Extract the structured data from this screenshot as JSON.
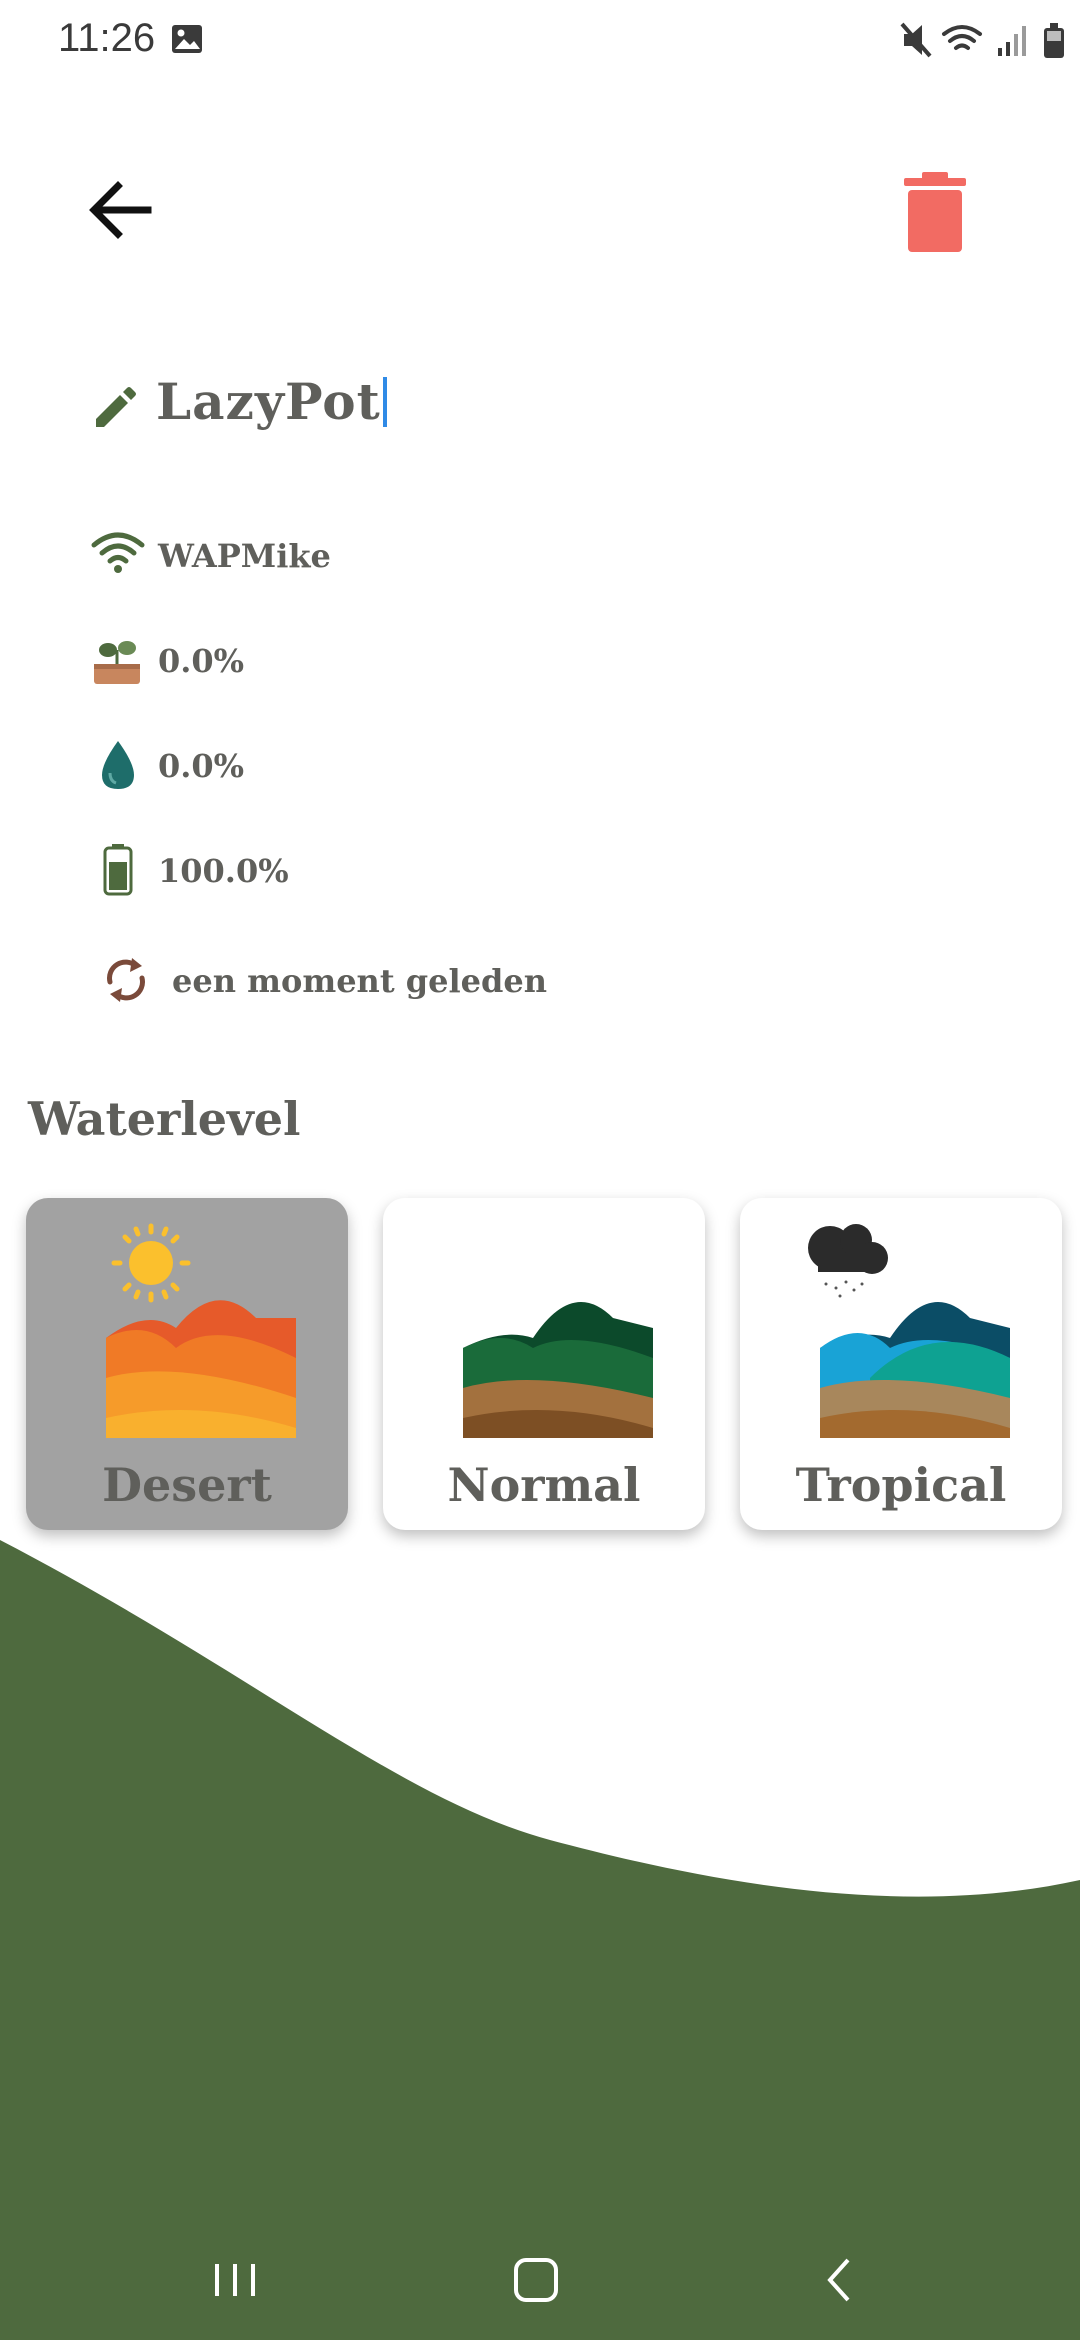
{
  "status_bar": {
    "time": "11:26",
    "icons": [
      "gallery-icon",
      "mute-icon",
      "wifi-icon",
      "signal-icon",
      "battery-icon"
    ]
  },
  "toolbar": {
    "back_icon": "arrow-left-icon",
    "delete_icon": "trash-icon",
    "delete_color": "#f26b63"
  },
  "device": {
    "name": "LazyPot",
    "edit_icon": "pencil-icon"
  },
  "info": {
    "wifi": "WAPMike",
    "soil": "0.0%",
    "water": "0.0%",
    "battery": "100.0%",
    "last_update": "een moment geleden"
  },
  "waterlevel": {
    "title": "Waterlevel",
    "options": [
      {
        "label": "Desert",
        "selected": true
      },
      {
        "label": "Normal",
        "selected": false
      },
      {
        "label": "Tropical",
        "selected": false
      }
    ]
  },
  "colors": {
    "accent_green": "#4e6a3e",
    "text": "#5f5f5b",
    "selected_card": "#a2a2a2"
  }
}
